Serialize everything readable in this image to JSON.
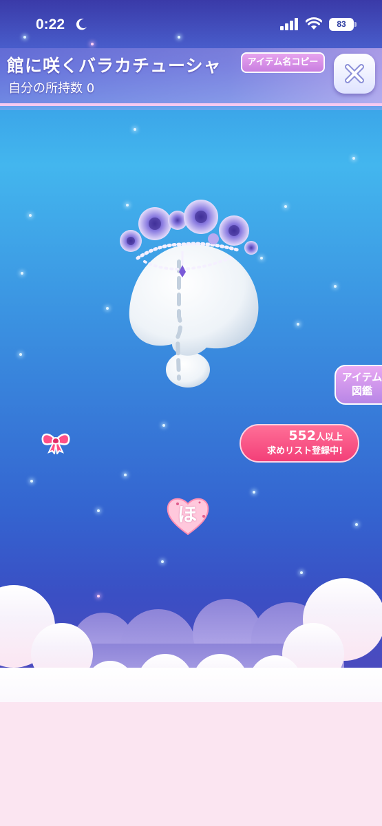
{
  "status_bar": {
    "time": "0:22",
    "battery": "83",
    "icons": [
      "moon-icon",
      "signal-icon",
      "wifi-icon",
      "battery-icon"
    ]
  },
  "header": {
    "item_name": "館に咲くバラカチューシャ",
    "owned_count": "自分の所持数 0",
    "copy_button": "アイテム名コピー",
    "close_icon": "close-icon"
  },
  "side": {
    "encyclopedia_line1": "アイテム",
    "encyclopedia_line2": "図鑑"
  },
  "wishlist": {
    "count": "552",
    "count_suffix": "人以上",
    "label": "求めリスト登録中!"
  },
  "hint": {
    "char": "ほ"
  },
  "colors": {
    "accent_pink": "#f33f78",
    "button_lilac": "#c97fe0",
    "rose_purple": "#8a7be0"
  }
}
